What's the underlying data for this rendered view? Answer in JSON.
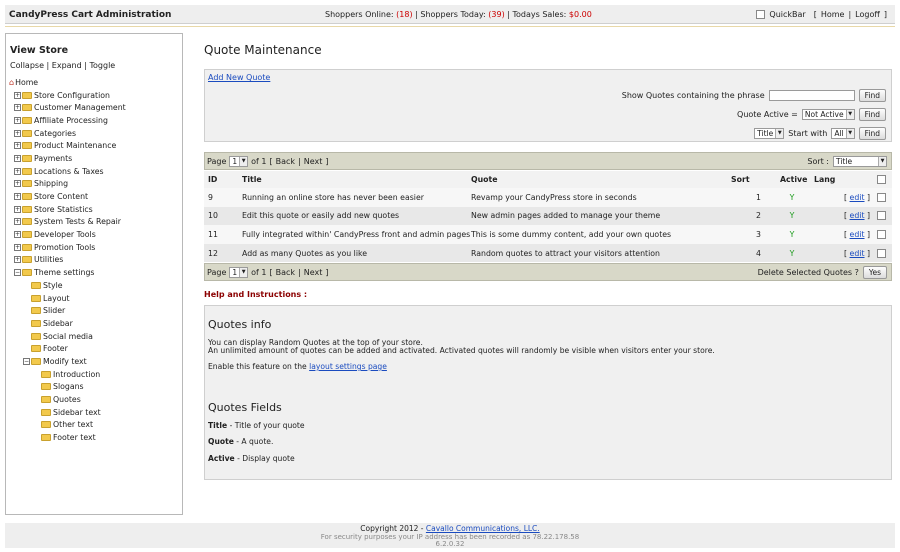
{
  "header": {
    "app_title": "CandyPress Cart Administration",
    "shoppers_online_label": "Shoppers Online:",
    "shoppers_online": "(18)",
    "shoppers_today_label": "| Shoppers Today:",
    "shoppers_today": "(39)",
    "todays_sales_label": "| Todays Sales:",
    "todays_sales": "$0.00",
    "quickbar_label": "QuickBar",
    "home_link": "Home",
    "logoff_link": "Logoff"
  },
  "sidebar": {
    "title": "View Store",
    "collapse": "Collapse",
    "expand": "Expand",
    "toggle": "Toggle",
    "home": "Home",
    "items": [
      "Store Configuration",
      "Customer Management",
      "Affiliate Processing",
      "Categories",
      "Product Maintenance",
      "Payments",
      "Locations & Taxes",
      "Shipping",
      "Store Content",
      "Store Statistics",
      "System Tests & Repair",
      "Developer Tools",
      "Promotion Tools",
      "Utilities"
    ],
    "theme_settings": "Theme settings",
    "theme_children": [
      "Style",
      "Layout",
      "Slider",
      "Sidebar",
      "Social media",
      "Footer"
    ],
    "modify_text": "Modify text",
    "modify_children": [
      "Introduction",
      "Slogans",
      "Quotes",
      "Sidebar text",
      "Other text",
      "Footer text"
    ]
  },
  "main": {
    "title": "Quote Maintenance",
    "add_new": "Add New Quote",
    "phrase_label": "Show Quotes containing the phrase",
    "phrase_value": "",
    "find": "Find",
    "active_label": "Quote Active =",
    "active_value": "Not Active",
    "title_select": "Title",
    "start_with_label": "Start with",
    "start_with_value": "All"
  },
  "pager": {
    "page_label": "Page",
    "page_value": "1",
    "of": "of 1",
    "back": "Back",
    "next": "Next",
    "sort_label": "Sort :",
    "sort_value": "Title",
    "delete_label": "Delete Selected Quotes ?",
    "yes": "Yes"
  },
  "table": {
    "headers": {
      "id": "ID",
      "title": "Title",
      "quote": "Quote",
      "sort": "Sort",
      "active": "Active",
      "lang": "Lang"
    },
    "edit": "edit",
    "rows": [
      {
        "id": "9",
        "title": "Running an online store has never been easier",
        "quote": "Revamp your CandyPress store in seconds",
        "sort": "1",
        "active": "Y"
      },
      {
        "id": "10",
        "title": "Edit this quote or easily add new quotes",
        "quote": "New admin pages added to manage your theme",
        "sort": "2",
        "active": "Y"
      },
      {
        "id": "11",
        "title": "Fully integrated within' CandyPress front and admin pages",
        "quote": "This is some dummy content, add your own quotes",
        "sort": "3",
        "active": "Y"
      },
      {
        "id": "12",
        "title": "Add as many Quotes as you like",
        "quote": "Random quotes to attract your visitors attention",
        "sort": "4",
        "active": "Y"
      }
    ]
  },
  "help": {
    "label": "Help and Instructions :",
    "info_heading": "Quotes info",
    "info_p1": "You can display Random Quotes at the top of your store.",
    "info_p2": "An unlimited amount of quotes can be added and activated. Activated quotes will randomly be visible when visitors enter your store.",
    "info_p3_pre": "Enable this feature on the",
    "info_p3_link": "layout settings page",
    "fields_heading": "Quotes Fields",
    "f_title_name": "Title",
    "f_title_desc": "- Title of your quote",
    "f_quote_name": "Quote",
    "f_quote_desc": "- A quote.",
    "f_active_name": "Active",
    "f_active_desc": "- Display quote"
  },
  "footer": {
    "copyright": "Copyright 2012 -",
    "company": "Cavallo Communications, LLC.",
    "security": "For security purposes your IP address has been recorded as 78.22.178.58",
    "version": "6.2.0.32"
  }
}
